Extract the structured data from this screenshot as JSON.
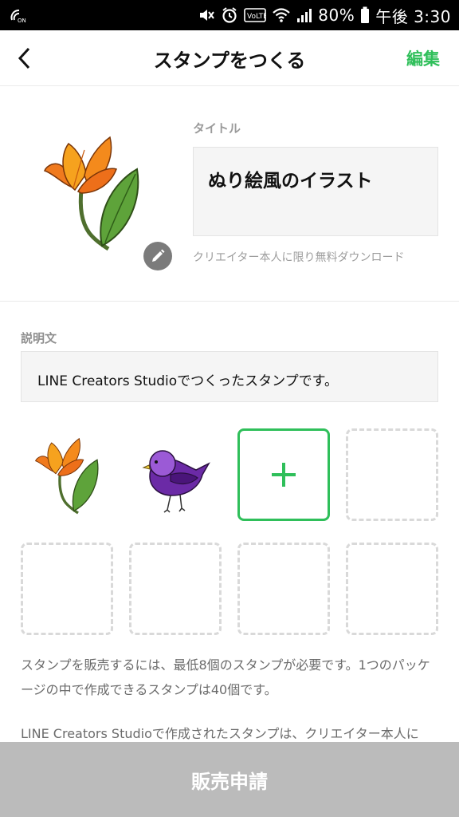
{
  "status_bar": {
    "icons": [
      "nfc-icon",
      "mute-icon",
      "alarm-icon",
      "volte-icon",
      "wifi-icon",
      "signal-icon",
      "battery-icon"
    ],
    "volte_text": "VoLTE",
    "battery": "80%",
    "time": "午後 3:30"
  },
  "header": {
    "back_icon": "chevron-left-icon",
    "title": "スタンプをつくる",
    "edit_label": "編集"
  },
  "sticker_info": {
    "title_label": "タイトル",
    "title_value": "ぬり絵風のイラスト",
    "note": "クリエイター本人に限り無料ダウンロード",
    "edit_icon": "pencil-icon"
  },
  "description": {
    "label": "説明文",
    "value": "LINE Creators Studioでつくったスタンプです。"
  },
  "grid": {
    "slots": [
      {
        "type": "filled",
        "image": "tulip-sticker"
      },
      {
        "type": "filled",
        "image": "purple-bird-sticker"
      },
      {
        "type": "add",
        "icon": "plus-icon"
      },
      {
        "type": "empty"
      },
      {
        "type": "empty"
      },
      {
        "type": "empty"
      },
      {
        "type": "empty"
      },
      {
        "type": "empty"
      }
    ]
  },
  "info": {
    "line1": "スタンプを販売するには、最低8個のスタンプが必要です。1つのパッケージの中で作成できるスタンプは40個です。",
    "line2": "LINE Creators Studioで作成されたスタンプは、クリエイター本人に"
  },
  "footer": {
    "sell_label": "販売申請"
  },
  "colors": {
    "accent": "#2fbf5a",
    "disabled_button": "#bbbbbb",
    "field_bg": "#f5f5f5"
  }
}
